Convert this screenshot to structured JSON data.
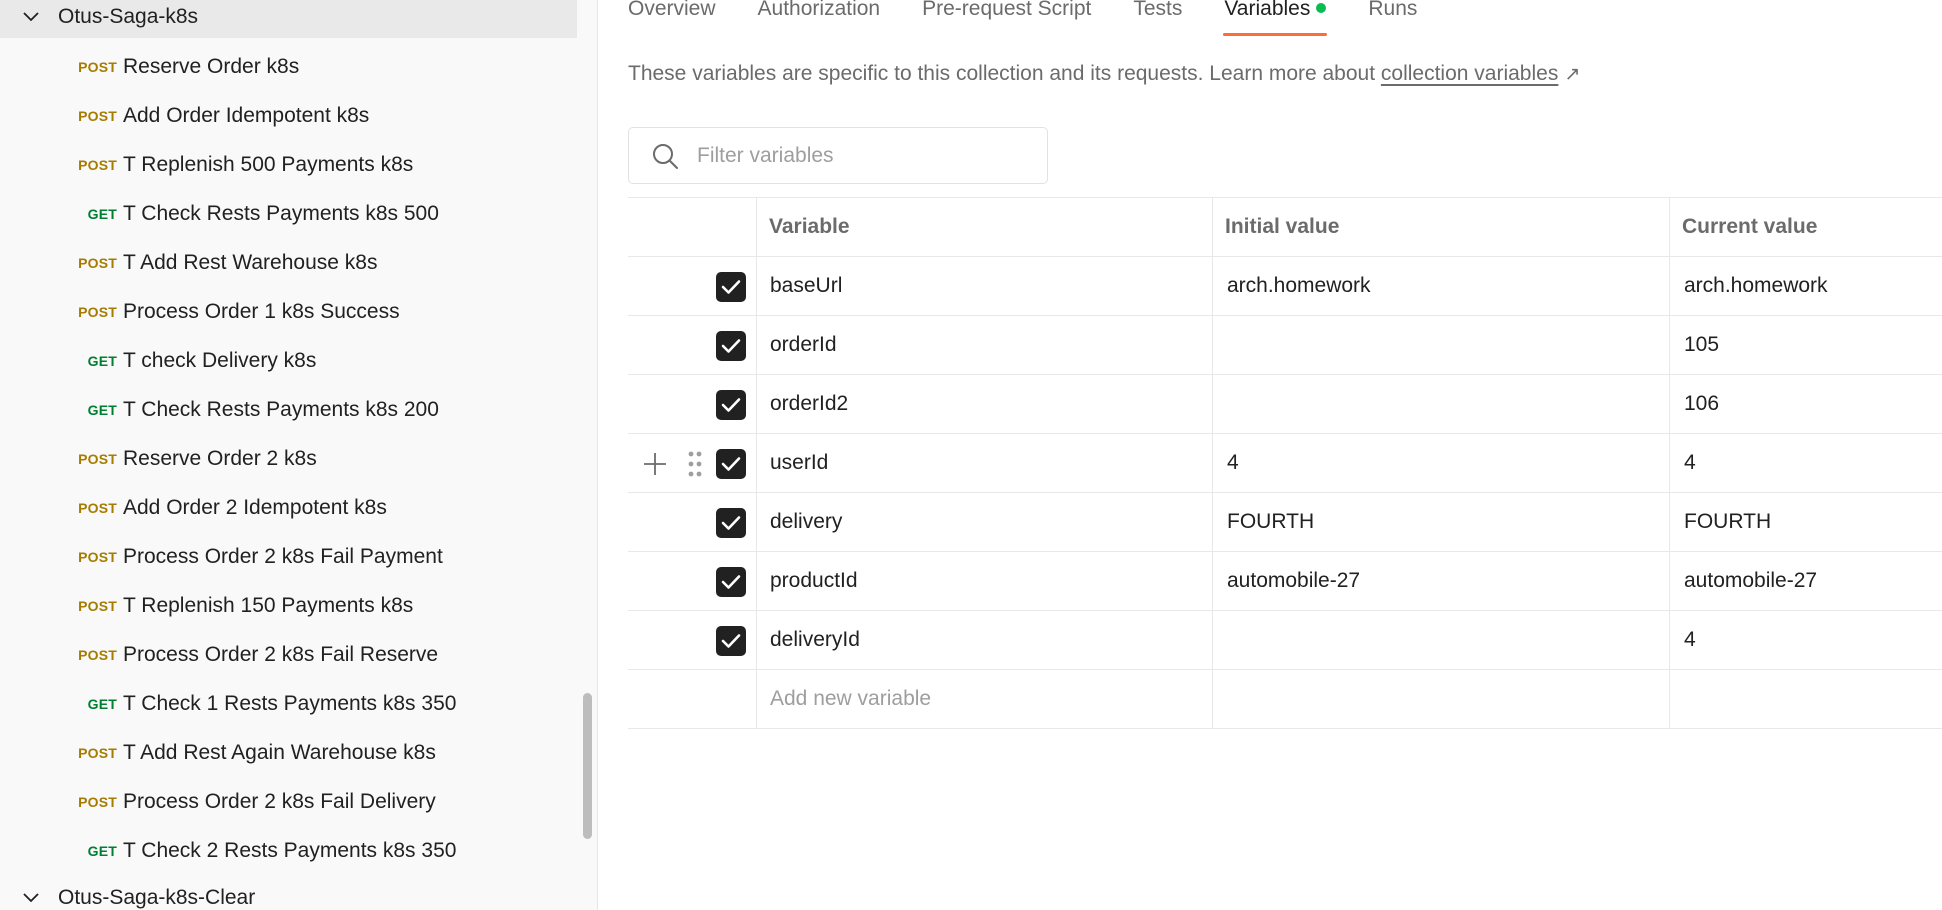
{
  "sidebar": {
    "folders": [
      {
        "label": "Otus-Saga-k8s",
        "expanded": true,
        "selected": true
      },
      {
        "label": "Otus-Saga-k8s-Clear",
        "expanded": true,
        "selected": false
      }
    ],
    "requests": [
      {
        "method": "POST",
        "label": "Reserve Order k8s"
      },
      {
        "method": "POST",
        "label": "Add Order Idempotent k8s"
      },
      {
        "method": "POST",
        "label": "T Replenish 500 Payments k8s"
      },
      {
        "method": "GET",
        "label": "T Check Rests Payments k8s 500"
      },
      {
        "method": "POST",
        "label": "T Add Rest Warehouse k8s"
      },
      {
        "method": "POST",
        "label": "Process Order 1 k8s Success"
      },
      {
        "method": "GET",
        "label": "T check Delivery k8s"
      },
      {
        "method": "GET",
        "label": "T Check Rests Payments k8s 200"
      },
      {
        "method": "POST",
        "label": "Reserve Order 2 k8s"
      },
      {
        "method": "POST",
        "label": "Add Order 2 Idempotent k8s"
      },
      {
        "method": "POST",
        "label": "Process Order 2 k8s Fail Payment"
      },
      {
        "method": "POST",
        "label": "T Replenish 150 Payments k8s"
      },
      {
        "method": "POST",
        "label": "Process Order 2 k8s Fail Reserve"
      },
      {
        "method": "GET",
        "label": "T Check 1 Rests Payments k8s 350"
      },
      {
        "method": "POST",
        "label": "T Add Rest Again Warehouse k8s"
      },
      {
        "method": "POST",
        "label": "Process Order 2 k8s Fail Delivery"
      },
      {
        "method": "GET",
        "label": "T Check 2 Rests Payments k8s 350"
      }
    ]
  },
  "tabs": [
    {
      "label": "Overview",
      "active": false
    },
    {
      "label": "Authorization",
      "active": false
    },
    {
      "label": "Pre-request Script",
      "active": false
    },
    {
      "label": "Tests",
      "active": false
    },
    {
      "label": "Variables",
      "active": true,
      "dot": true
    },
    {
      "label": "Runs",
      "active": false
    }
  ],
  "description": {
    "text": "These variables are specific to this collection and its requests. Learn more about ",
    "link": "collection variables",
    "arrow": "↗"
  },
  "filter": {
    "placeholder": "Filter variables",
    "value": ""
  },
  "table": {
    "headers": {
      "variable": "Variable",
      "initial": "Initial value",
      "current": "Current value"
    },
    "rows": [
      {
        "checked": true,
        "variable": "baseUrl",
        "initial": "arch.homework",
        "current": "arch.homework",
        "hovered": false
      },
      {
        "checked": true,
        "variable": "orderId",
        "initial": "",
        "current": "105",
        "hovered": false
      },
      {
        "checked": true,
        "variable": "orderId2",
        "initial": "",
        "current": "106",
        "hovered": false
      },
      {
        "checked": true,
        "variable": "userId",
        "initial": "4",
        "current": "4",
        "hovered": true
      },
      {
        "checked": true,
        "variable": "delivery",
        "initial": "FOURTH",
        "current": "FOURTH",
        "hovered": false
      },
      {
        "checked": true,
        "variable": "productId",
        "initial": "automobile-27",
        "current": "automobile-27",
        "hovered": false
      },
      {
        "checked": true,
        "variable": "deliveryId",
        "initial": "",
        "current": "4",
        "hovered": false
      }
    ],
    "add_new_placeholder": "Add new variable"
  },
  "colors": {
    "accent": "#ff6c37",
    "post": "#a67c00",
    "get": "#007f31",
    "dot": "#0cbb52"
  }
}
